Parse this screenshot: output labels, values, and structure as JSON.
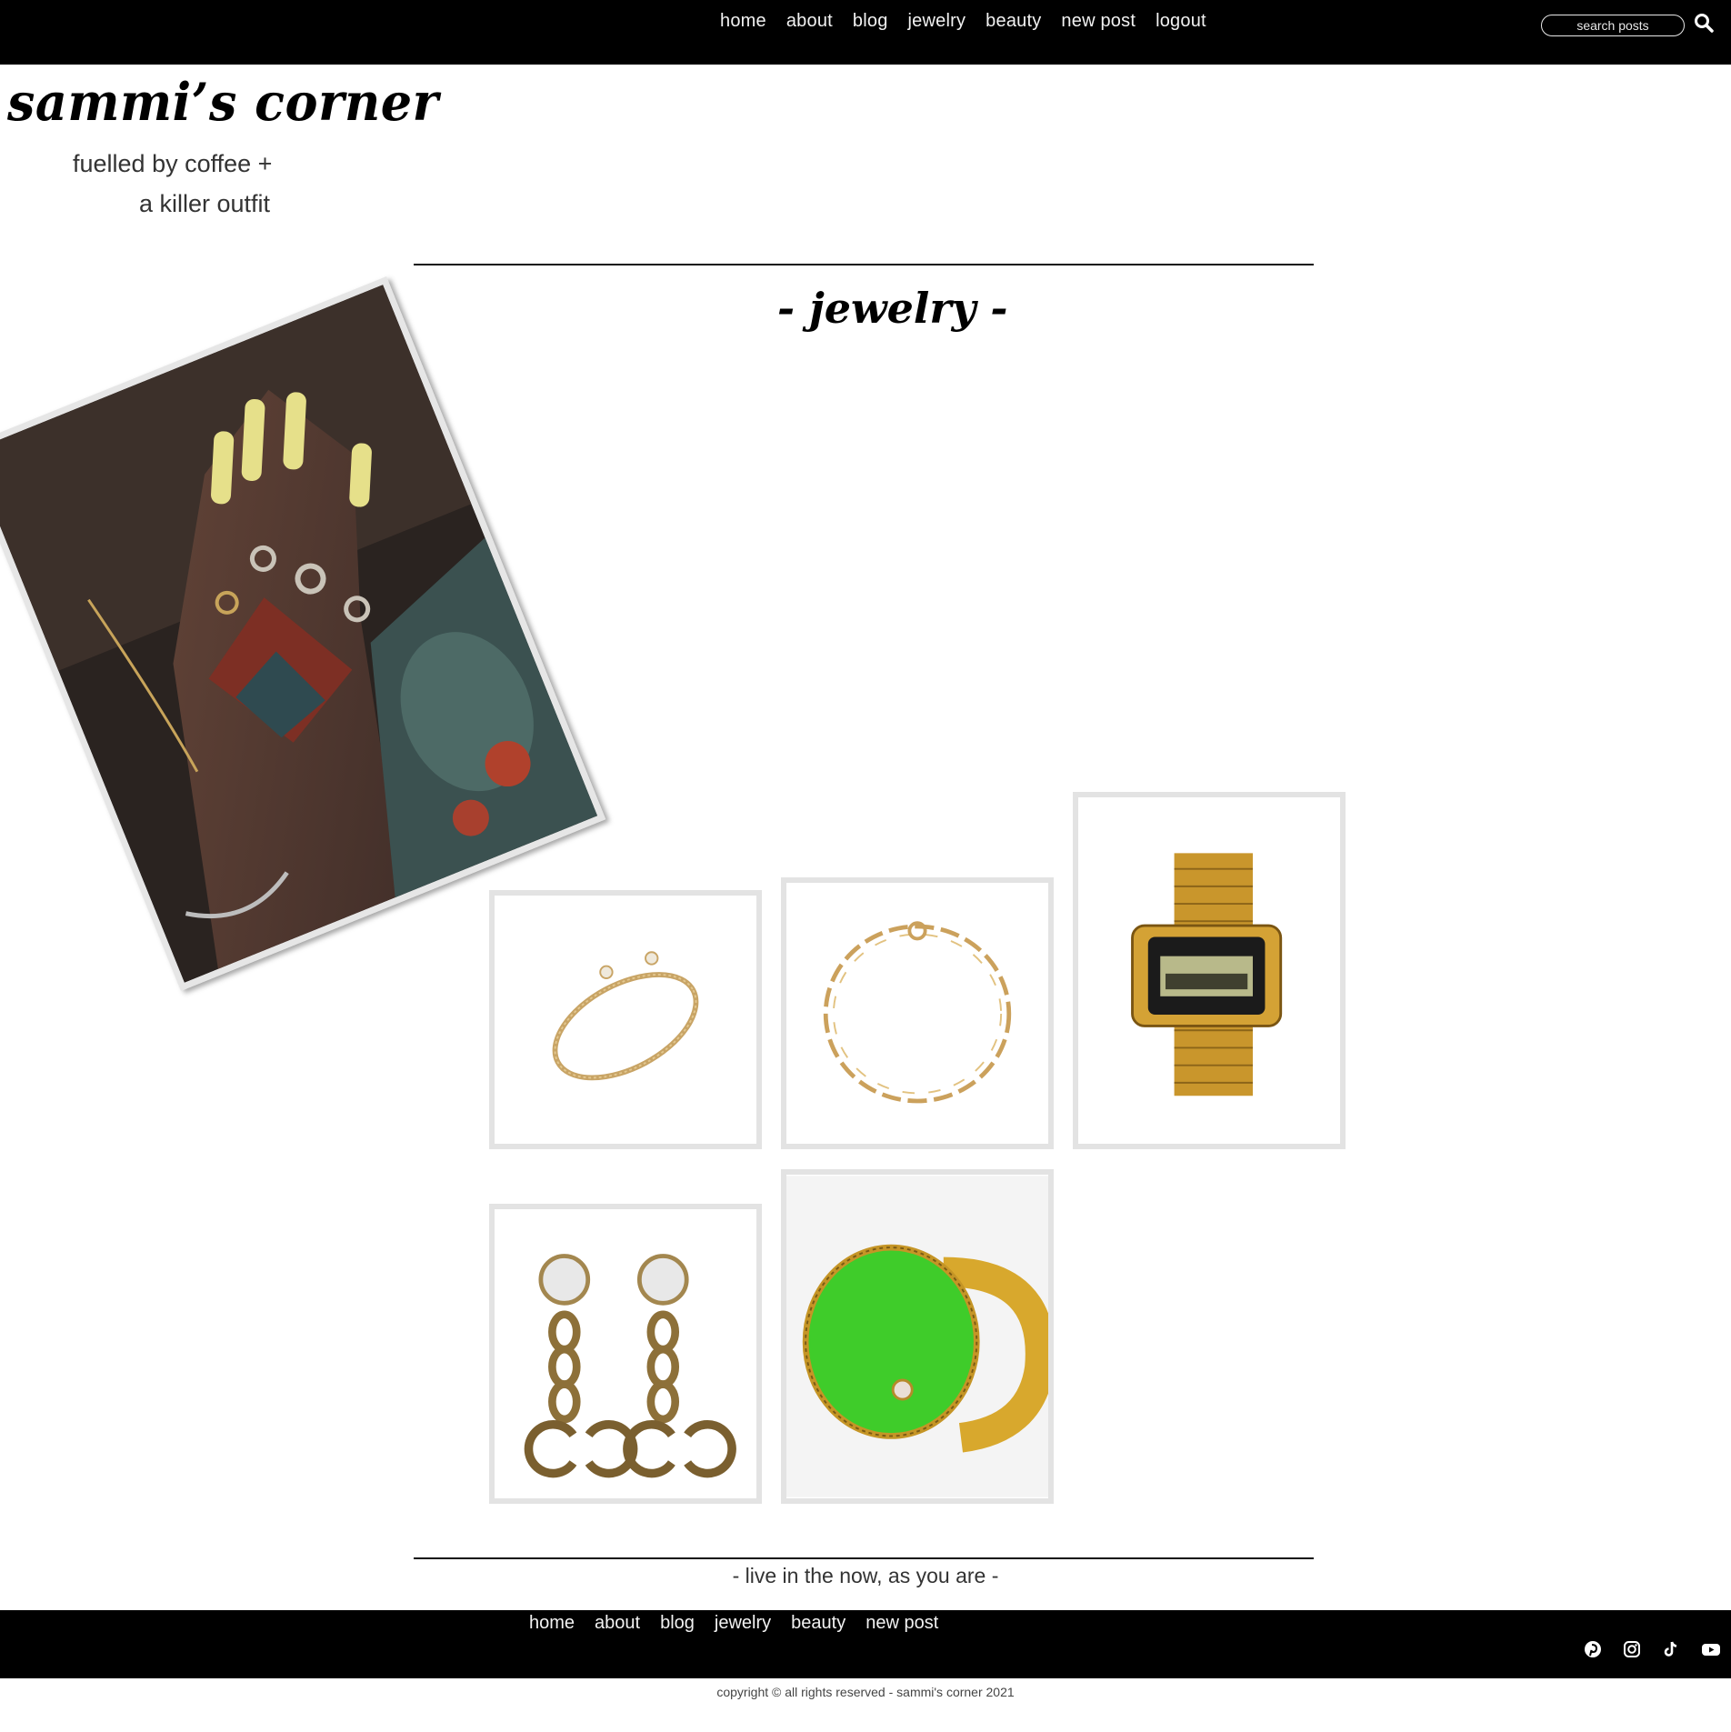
{
  "nav": {
    "items": [
      "home",
      "about",
      "blog",
      "jewelry",
      "beauty",
      "new post",
      "logout"
    ],
    "search_placeholder": "search posts",
    "search_icon": "search-icon"
  },
  "brand": {
    "title": "sammi’s corner",
    "tagline_line1": "fuelled by coffee +",
    "tagline_line2": "a killer outfit"
  },
  "section": {
    "heading": "- jewelry -"
  },
  "products": [
    {
      "name": "gold cable cuff bracelet"
    },
    {
      "name": "gold chain link bracelet"
    },
    {
      "name": "gold digital watch"
    },
    {
      "name": "gg crystal chain earrings"
    },
    {
      "name": "green enamel signet ring"
    }
  ],
  "footer": {
    "quote": "- live in the now, as you are -",
    "nav": [
      "home",
      "about",
      "blog",
      "jewelry",
      "beauty",
      "new post"
    ],
    "social": [
      "pinterest-icon",
      "instagram-icon",
      "tiktok-icon",
      "youtube-icon"
    ],
    "copyright": "copyright © all rights reserved - sammi's corner 2021"
  }
}
